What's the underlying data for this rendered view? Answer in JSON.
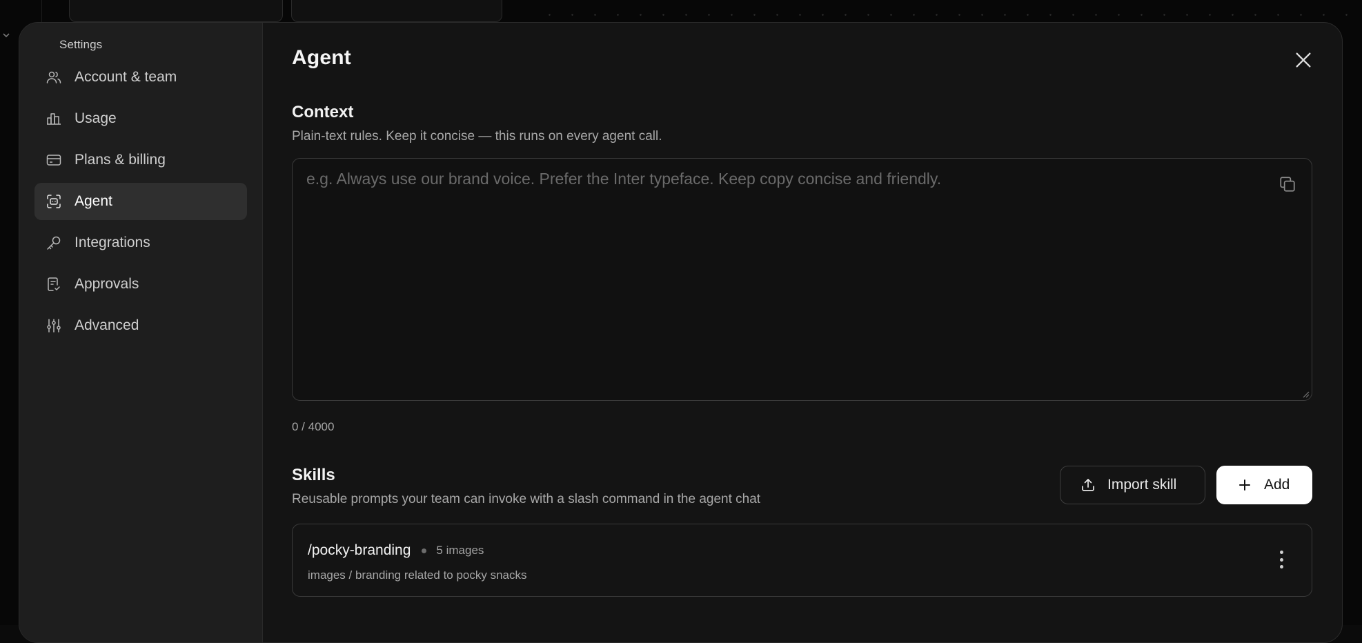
{
  "sidebar": {
    "title": "Settings",
    "items": [
      {
        "label": "Account & team",
        "icon": "users-icon"
      },
      {
        "label": "Usage",
        "icon": "bar-chart-icon"
      },
      {
        "label": "Plans & billing",
        "icon": "credit-card-icon"
      },
      {
        "label": "Agent",
        "icon": "agent-scan-icon",
        "active": true
      },
      {
        "label": "Integrations",
        "icon": "key-icon"
      },
      {
        "label": "Approvals",
        "icon": "approval-document-icon"
      },
      {
        "label": "Advanced",
        "icon": "sliders-icon"
      }
    ]
  },
  "page": {
    "title": "Agent"
  },
  "context": {
    "heading": "Context",
    "description": "Plain-text rules. Keep it concise — this runs on every agent call.",
    "placeholder": "e.g. Always use our brand voice. Prefer the Inter typeface. Keep copy concise and friendly.",
    "value": "",
    "char_count": "0 / 4000"
  },
  "skills": {
    "heading": "Skills",
    "description": "Reusable prompts your team can invoke with a slash command in the agent chat",
    "import_label": "Import skill",
    "add_label": "Add",
    "items": [
      {
        "name": "/pocky-branding",
        "meta": "5 images",
        "description": "images / branding related to pocky snacks"
      }
    ]
  },
  "colors": {
    "modal_bg": "#141414",
    "sidebar_bg": "#1e1e1e",
    "active_item_bg": "#2f2f2f",
    "primary_button_bg": "#ffffff"
  }
}
